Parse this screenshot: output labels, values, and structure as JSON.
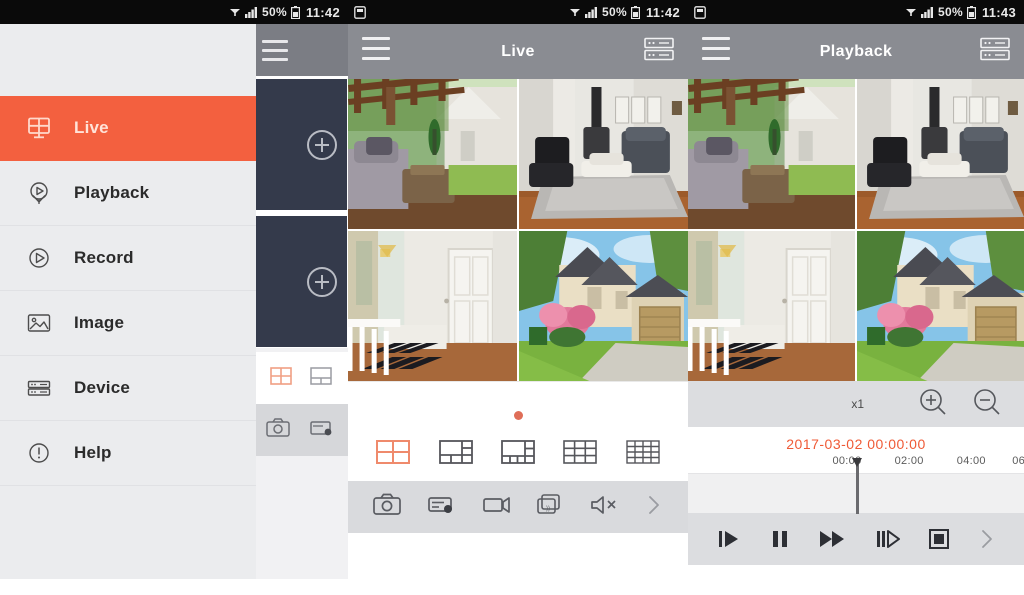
{
  "app": {
    "accent_color": "#f3603f",
    "header_bg": "#8a8c92",
    "drawer_bg": "#ebecee",
    "toolbar_bg": "#d9dadd"
  },
  "panels": [
    {
      "id": "drawer-panel",
      "statusbar": {
        "battery_percent": "50%",
        "time": "11:42",
        "wifi_icon": "wifi-icon",
        "signal_icon": "signal-bars-icon",
        "battery_icon": "battery-icon"
      },
      "drawer": {
        "items": [
          {
            "label": "Live",
            "icon": "live-grid-monitor-icon",
            "active": true
          },
          {
            "label": "Playback",
            "icon": "playback-circle-icon",
            "active": false
          },
          {
            "label": "Record",
            "icon": "record-circle-icon",
            "active": false
          },
          {
            "label": "Image",
            "icon": "image-picture-icon",
            "active": false
          },
          {
            "label": "Device",
            "icon": "device-server-icon",
            "active": false
          },
          {
            "label": "Help",
            "icon": "help-exclamation-icon",
            "active": false
          }
        ]
      },
      "behind": {
        "menu_icon": "hamburger-menu-icon",
        "cells": [
          {
            "add_icon": "plus-circle-icon"
          },
          {
            "add_icon": "plus-circle-icon"
          }
        ],
        "layout_icons": [
          "layout-4-split-icon",
          "layout-6-split-icon"
        ],
        "tool_icons": [
          "snapshot-camera-icon",
          "record-video-icon"
        ]
      }
    },
    {
      "id": "live-panel",
      "statusbar": {
        "left_icon": "sd-card-icon",
        "battery_percent": "50%",
        "time": "11:42",
        "wifi_icon": "wifi-icon",
        "signal_icon": "signal-bars-icon",
        "battery_icon": "battery-icon"
      },
      "header": {
        "menu_icon": "hamburger-menu-icon",
        "title": "Live",
        "right_icon": "device-list-icon"
      },
      "grid": {
        "cells": [
          {
            "name": "camera-patio-garden"
          },
          {
            "name": "camera-living-room"
          },
          {
            "name": "camera-front-porch"
          },
          {
            "name": "camera-house-garage"
          }
        ]
      },
      "status_indicator": "recording-dot",
      "layouts": [
        {
          "icon": "layout-4-split-icon",
          "label": "4",
          "active": true
        },
        {
          "icon": "layout-6-split-icon",
          "label": "6",
          "active": false
        },
        {
          "icon": "layout-8-split-icon",
          "label": "8",
          "active": false
        },
        {
          "icon": "layout-9-split-icon",
          "label": "9",
          "active": false
        },
        {
          "icon": "layout-16-split-icon",
          "label": "16",
          "active": false
        }
      ],
      "toolbar": [
        {
          "icon": "snapshot-camera-icon"
        },
        {
          "icon": "record-stream-icon"
        },
        {
          "icon": "video-camera-icon"
        },
        {
          "icon": "two-way-talk-icon"
        },
        {
          "icon": "mute-speaker-icon"
        },
        {
          "icon": "chevron-right-icon"
        }
      ]
    },
    {
      "id": "playback-panel",
      "statusbar": {
        "left_icon": "sd-card-icon",
        "battery_percent": "50%",
        "time": "11:43",
        "wifi_icon": "wifi-icon",
        "signal_icon": "signal-bars-icon",
        "battery_icon": "battery-icon"
      },
      "header": {
        "menu_icon": "hamburger-menu-icon",
        "title": "Playback",
        "right_icon": "device-list-icon"
      },
      "grid": {
        "cells": [
          {
            "name": "camera-patio-garden"
          },
          {
            "name": "camera-living-room"
          },
          {
            "name": "camera-front-porch"
          },
          {
            "name": "camera-house-garage"
          }
        ]
      },
      "zoom_row": {
        "speed_label": "x1",
        "zoom_in_icon": "zoom-in-magnifier-icon",
        "zoom_out_icon": "zoom-out-magnifier-icon"
      },
      "timeline": {
        "current_datetime": "2017-03-02 00:00:00",
        "date_color": "#ef5a36",
        "ticks": [
          {
            "label": "00:00",
            "pos_pct": 50
          },
          {
            "label": "02:00",
            "pos_pct": 68
          },
          {
            "label": "04:00",
            "pos_pct": 85
          },
          {
            "label": "06",
            "pos_pct": 98
          }
        ]
      },
      "controls": [
        {
          "icon": "frame-step-forward-icon"
        },
        {
          "icon": "pause-icon"
        },
        {
          "icon": "fast-forward-icon"
        },
        {
          "icon": "slow-forward-icon"
        },
        {
          "icon": "stop-icon"
        },
        {
          "icon": "chevron-right-icon"
        }
      ]
    }
  ]
}
